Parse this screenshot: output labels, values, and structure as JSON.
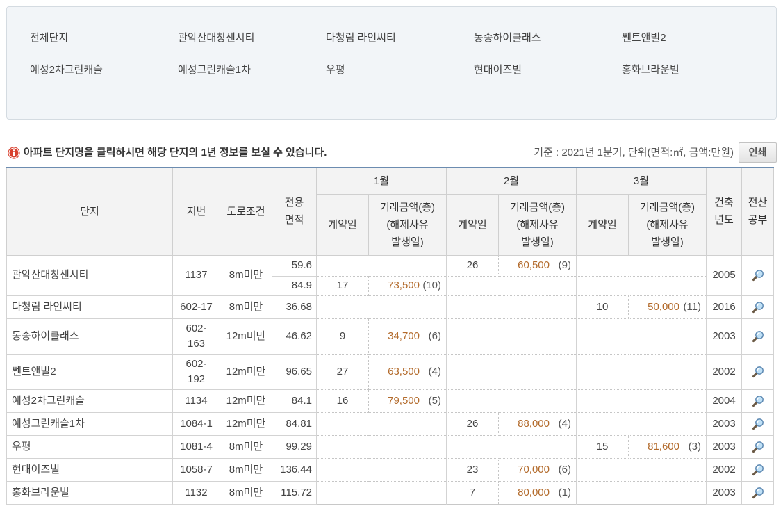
{
  "complex_nav": [
    "전체단지",
    "관악산대창센시티",
    "다청림 라인씨티",
    "동송하이클래스",
    "쎈트앤빌2",
    "예성2차그린캐슬",
    "예성그린캐슬1차",
    "우평",
    "현대이즈빌",
    "홍화브라운빌"
  ],
  "notice": {
    "icon": "info-icon",
    "text": "아파트 단지명을 클릭하시면 해당 단지의 1년 정보를 보실 수 있습니다.",
    "basis": "기준 : 2021년 1분기, 단위(면적:㎡, 금액:만원)",
    "print_label": "인쇄"
  },
  "colors": {
    "table_top_border": "#6c8cb0",
    "price_text": "#b36b2c",
    "info_icon": "#d8412f",
    "header_bg": "#f3f3f3",
    "nav_box_bg": "#f2f5f8"
  },
  "table": {
    "headers": {
      "complex": "단지",
      "lot": "지번",
      "road": "도로조건",
      "area": "전용\n면적",
      "months": [
        "1월",
        "2월",
        "3월"
      ],
      "contract_day": "계약일",
      "price": "거래금액(층)\n(해제사유\n발생일)",
      "built_year": "건축\n년도",
      "registry": "전산\n공부"
    },
    "registry_icon": "magnifier-icon",
    "rows": [
      {
        "complex": "관악산대창센시티",
        "lot": "1137",
        "road": "8m미만",
        "built_year": "2005",
        "units": [
          {
            "area": "59.6",
            "feb": {
              "day": "26",
              "price": "60,500",
              "floor": "(9)"
            }
          },
          {
            "area": "84.9",
            "jan": {
              "day": "17",
              "price": "73,500",
              "floor": "(10)"
            }
          }
        ]
      },
      {
        "complex": "다청림 라인씨티",
        "lot": "602-17",
        "road": "8m미만",
        "built_year": "2016",
        "units": [
          {
            "area": "36.68",
            "mar": {
              "day": "10",
              "price": "50,000",
              "floor": "(11)"
            }
          }
        ]
      },
      {
        "complex": "동송하이클래스",
        "lot": "602-163",
        "road": "12m미만",
        "built_year": "2003",
        "units": [
          {
            "area": "46.62",
            "jan": {
              "day": "9",
              "price": "34,700",
              "floor": "(6)"
            }
          }
        ]
      },
      {
        "complex": "쎈트앤빌2",
        "lot": "602-192",
        "road": "12m미만",
        "built_year": "2002",
        "units": [
          {
            "area": "96.65",
            "jan": {
              "day": "27",
              "price": "63,500",
              "floor": "(4)"
            }
          }
        ]
      },
      {
        "complex": "예성2차그린캐슬",
        "lot": "1134",
        "road": "12m미만",
        "built_year": "2004",
        "units": [
          {
            "area": "84.1",
            "jan": {
              "day": "16",
              "price": "79,500",
              "floor": "(5)"
            }
          }
        ]
      },
      {
        "complex": "예성그린캐슬1차",
        "lot": "1084-1",
        "road": "12m미만",
        "built_year": "2003",
        "units": [
          {
            "area": "84.81",
            "feb": {
              "day": "26",
              "price": "88,000",
              "floor": "(4)"
            }
          }
        ]
      },
      {
        "complex": "우평",
        "lot": "1081-4",
        "road": "8m미만",
        "built_year": "2003",
        "units": [
          {
            "area": "99.29",
            "mar": {
              "day": "15",
              "price": "81,600",
              "floor": "(3)"
            }
          }
        ]
      },
      {
        "complex": "현대이즈빌",
        "lot": "1058-7",
        "road": "8m미만",
        "built_year": "2002",
        "units": [
          {
            "area": "136.44",
            "feb": {
              "day": "23",
              "price": "70,000",
              "floor": "(6)"
            }
          }
        ]
      },
      {
        "complex": "홍화브라운빌",
        "lot": "1132",
        "road": "8m미만",
        "built_year": "2003",
        "units": [
          {
            "area": "115.72",
            "feb": {
              "day": "7",
              "price": "80,000",
              "floor": "(1)"
            }
          }
        ]
      }
    ]
  }
}
